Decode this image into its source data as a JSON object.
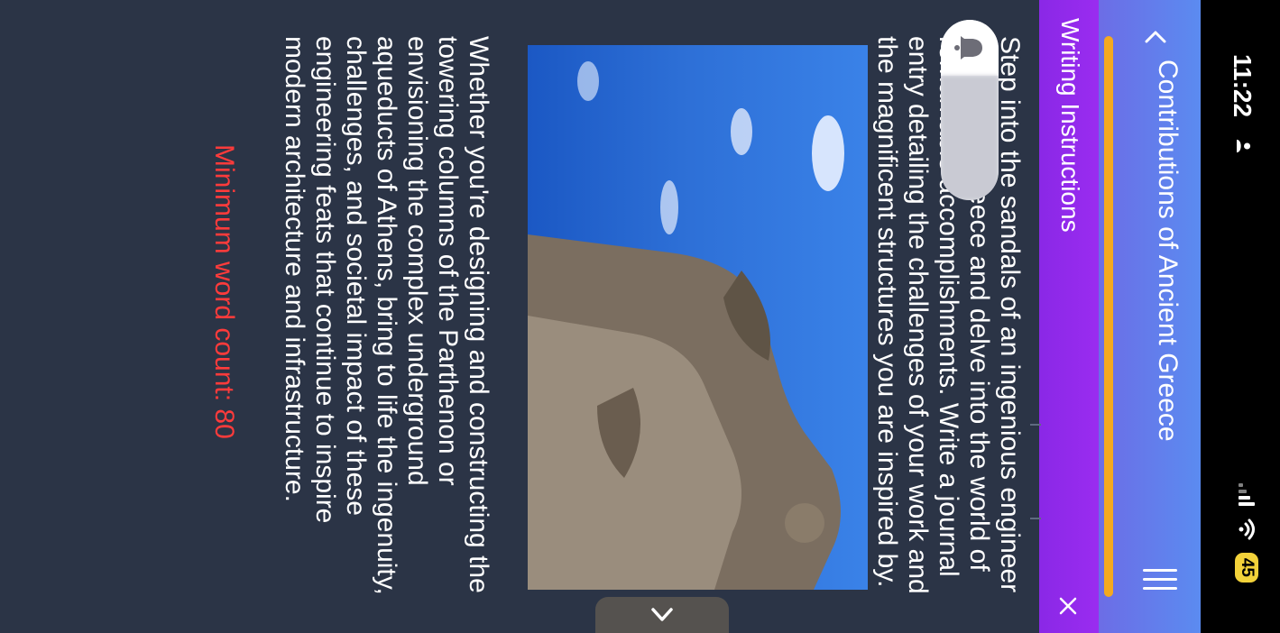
{
  "status_bar": {
    "time": "11:22",
    "battery": "45"
  },
  "header": {
    "title": "Contributions of Ancient Greece",
    "accent_color": "#f4a91f"
  },
  "panel": {
    "title": "Writing Instructions"
  },
  "content": {
    "paragraph1": "Step into the sandals of an ingenious engineer in ancient Greece and delve into the world of remarkable accomplishments. Write a journal entry detailing the challenges of your work and the magnificent structures you are inspired by.",
    "paragraph2": "Whether you're designing and constructing the towering columns of the Parthenon or envisioning the complex underground aqueducts of Athens, bring to life the ingenuity, challenges, and societal impact of these engineering feats that continue to inspire modern architecture and infrastructure.",
    "word_count_label": "Minimum word count: 80",
    "word_count_color": "#ff3b3b"
  },
  "icons": {
    "back": "chevron-left-icon",
    "menu": "menu-icon",
    "close": "close-icon",
    "notification": "bell-icon",
    "handle": "chevron-down-icon"
  }
}
